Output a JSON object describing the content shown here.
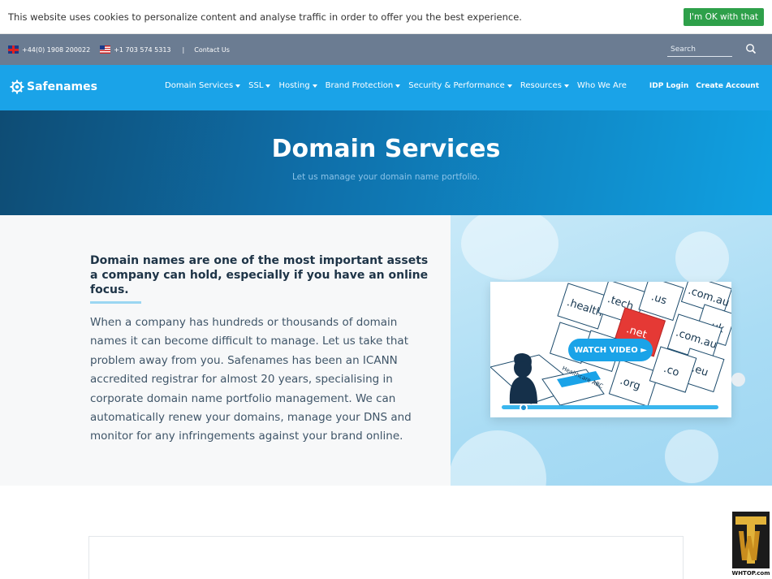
{
  "cookie": {
    "message": "This website uses cookies to personalize content and analyse traffic in order to offer you the best experience.",
    "accept_label": "I'm OK with that"
  },
  "topbar": {
    "phone_uk": "+44(0) 1908 200022",
    "phone_us": "+1 703 574 5313",
    "separator": "|",
    "contact": "Contact Us",
    "search_placeholder": "Search"
  },
  "nav": {
    "logo": "Safenames",
    "items": [
      {
        "label": "Domain Services",
        "dropdown": true
      },
      {
        "label": "SSL",
        "dropdown": true
      },
      {
        "label": "Hosting",
        "dropdown": true
      },
      {
        "label": "Brand Protection",
        "dropdown": true
      },
      {
        "label": "Security & Performance",
        "dropdown": true
      },
      {
        "label": "Resources",
        "dropdown": true
      },
      {
        "label": "Who We Are",
        "dropdown": false
      }
    ],
    "idp_login": "IDP Login",
    "create_account": "Create Account"
  },
  "hero": {
    "title": "Domain Services",
    "subtitle": "Let us manage your domain name portfolio."
  },
  "content": {
    "lead": "Domain names are one of the most important assets a company can hold, especially if you have an online focus.",
    "body": "When a company has hundreds or thousands of domain names it can become difficult to manage. Let us take that problem away from you. Safenames has been an ICANN accredited registrar for almost 20 years, specialising in corporate domain name portfolio management. We can automatically renew your domains, manage your DNS and monitor for any infringements against your brand online."
  },
  "video": {
    "watch_label": "WATCH VIDEO ►",
    "tiles": [
      ".health",
      ".tech",
      ".us",
      ".com.au",
      ".uk",
      ".net",
      ".com.au",
      ".eu",
      ".org",
      ".co",
      "Healthcare ABC"
    ],
    "progress": 0.1
  },
  "watermark": {
    "text": "WHTOP.com"
  },
  "colors": {
    "brand_blue": "#1aa3e8",
    "topbar": "#6b7c92",
    "accept_green": "#2ea04a",
    "highlight_red": "#e53935"
  }
}
